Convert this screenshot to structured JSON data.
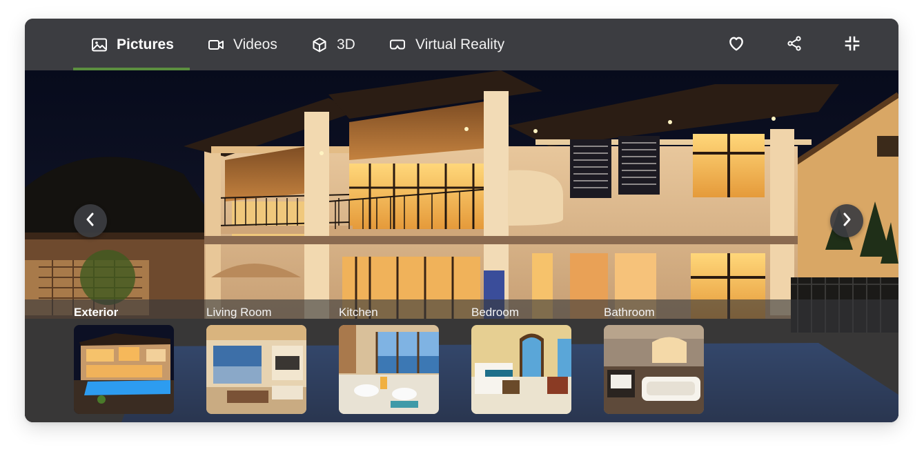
{
  "tabs": [
    {
      "label": "Pictures",
      "icon": "image-icon",
      "active": true
    },
    {
      "label": "Videos",
      "icon": "video-camera-icon",
      "active": false
    },
    {
      "label": "3D",
      "icon": "cube-icon",
      "active": false
    },
    {
      "label": "Virtual Reality",
      "icon": "vr-headset-icon",
      "active": false
    }
  ],
  "actions": [
    {
      "name": "favorite",
      "icon": "heart-icon"
    },
    {
      "name": "share",
      "icon": "share-icon"
    },
    {
      "name": "exit-fullscreen",
      "icon": "collapse-icon"
    }
  ],
  "navigation": {
    "previous_icon": "chevron-left-icon",
    "next_icon": "chevron-right-icon"
  },
  "gallery": [
    {
      "label": "Exterior",
      "active": true
    },
    {
      "label": "Living Room",
      "active": false
    },
    {
      "label": "Kitchen",
      "active": false
    },
    {
      "label": "Bedroom",
      "active": false
    },
    {
      "label": "Bathroom",
      "active": false
    }
  ],
  "colors": {
    "topbar": "#3c3d41",
    "accent": "#5b8f3f",
    "strip": "#37383c"
  }
}
